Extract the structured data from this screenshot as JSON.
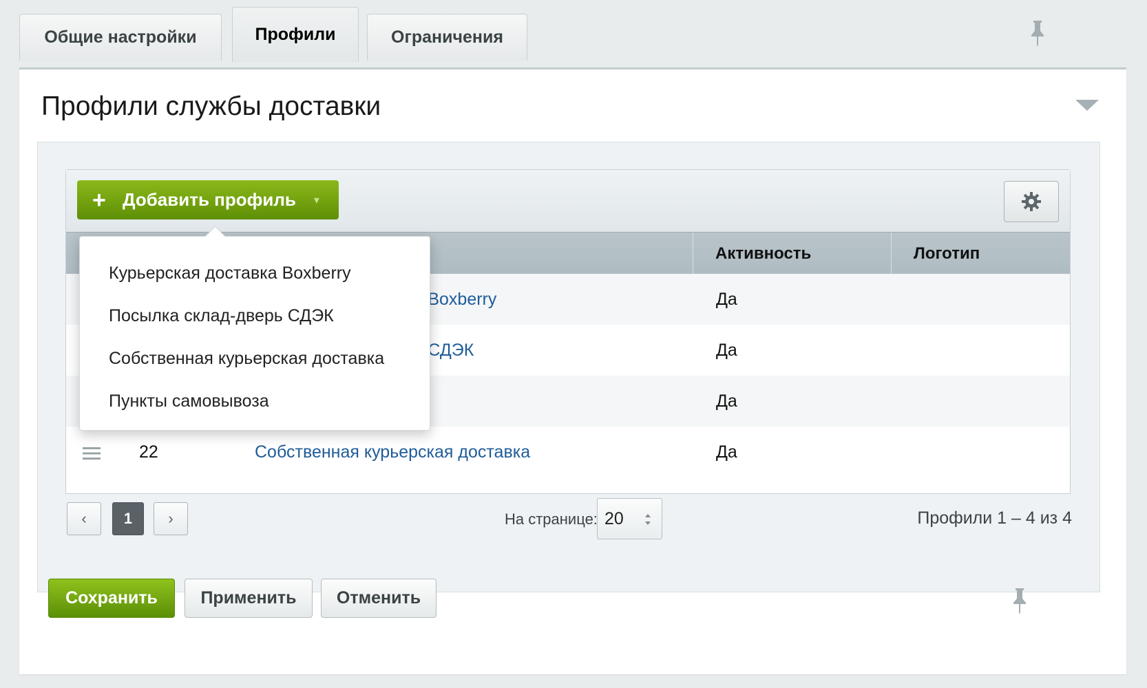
{
  "tabs": [
    {
      "label": "Общие настройки"
    },
    {
      "label": "Профили"
    },
    {
      "label": "Ограничения"
    }
  ],
  "section": {
    "title": "Профили службы доставки"
  },
  "toolbar": {
    "add_label": "Добавить профиль"
  },
  "table": {
    "columns": {
      "activity": "Активность",
      "logo": "Логотип"
    },
    "rows": [
      {
        "id": "",
        "name": "Курьерская доставка Boxberry",
        "name_visible": "ка Boxberry",
        "active": "Да"
      },
      {
        "id": "",
        "name": "Посылка склад-дверь СДЭК",
        "name_visible": "ка СДЭК",
        "active": "Да"
      },
      {
        "id": "",
        "name": "Пункты самовывоза",
        "name_visible": "а",
        "active": "Да"
      },
      {
        "id": "22",
        "name": "Собственная курьерская доставка",
        "name_visible": "Собственная курьерская доставка",
        "active": "Да"
      }
    ]
  },
  "dropdown": {
    "items": [
      {
        "label": "Курьерская доставка Boxberry"
      },
      {
        "label": "Посылка склад-дверь СДЭК"
      },
      {
        "label": "Собственная курьерская доставка"
      },
      {
        "label": "Пункты самовывоза"
      }
    ]
  },
  "pager": {
    "current_page": "1",
    "per_page_label": "На странице:",
    "per_page_value": "20",
    "total": "Профили 1 – 4 из 4"
  },
  "footer": {
    "save": "Сохранить",
    "apply": "Применить",
    "cancel": "Отменить"
  },
  "colors": {
    "accent_green": "#6b9c0c",
    "link_blue": "#1f5c99",
    "header_gray": "#b3c0c6"
  }
}
